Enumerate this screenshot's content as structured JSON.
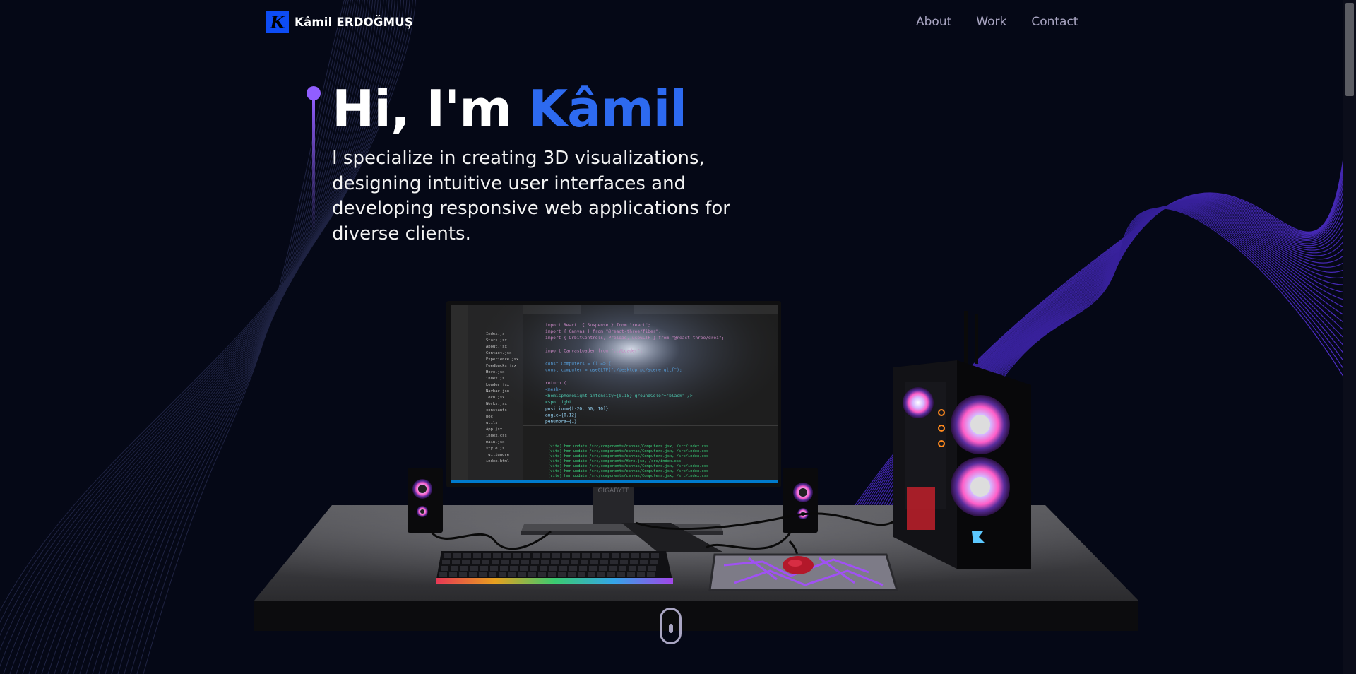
{
  "brand": {
    "initial": "K",
    "name": "Kâmil ERDOĞMUŞ"
  },
  "nav": {
    "links": [
      "About",
      "Work",
      "Contact"
    ]
  },
  "hero": {
    "greeting": "Hi, I'm ",
    "name": "Kâmil",
    "subtitle": "I specialize in creating 3D visualizations, designing intuitive user interfaces and developing responsive web applications for diverse clients."
  },
  "monitor": {
    "brand": "GIGABYTE",
    "active_tab": "Computers.jsx",
    "code_lines": [
      "import React, { Suspense } from \"react\";",
      "import { Canvas } from \"@react-three/fiber\";",
      "import { OrbitControls, Preload, useGLTF } from \"@react-three/drei\";",
      "",
      "import CanvasLoader from \"../Loader\";",
      "",
      "const Computers = () => {",
      "  const computer = useGLTF(\"./desktop_pc/scene.gltf\");",
      "",
      "  return (",
      "    <mesh>",
      "      <hemisphereLight intensity={0.15} groundColor=\"black\" />",
      "      <spotLight",
      "        position={[-20, 50, 10]}",
      "        angle={0.12}",
      "        penumbra={1}"
    ],
    "terminal_lines": [
      "[vite] hmr update /src/components/canvas/Computers.jsx, /src/index.css",
      "[vite] hmr update /src/components/canvas/Computers.jsx, /src/index.css",
      "[vite] hmr update /src/components/canvas/Computers.jsx, /src/index.css",
      "[vite] hmr update /src/components/Hero.jsx, /src/index.css",
      "[vite] hmr update /src/components/canvas/Computers.jsx, /src/index.css",
      "[vite] hmr update /src/components/canvas/Computers.jsx, /src/index.css",
      "[vite] hmr update /src/components/canvas/Computers.jsx, /src/index.css"
    ]
  },
  "colors": {
    "background": "#050816",
    "accent": "#2d6af0",
    "timeline": "#915eff",
    "nav_text": "#aaa6c3",
    "logo_badge": "#0d4cf5"
  },
  "icons": {
    "logo": "k-logo-icon",
    "scroll": "scroll-mouse-icon"
  }
}
